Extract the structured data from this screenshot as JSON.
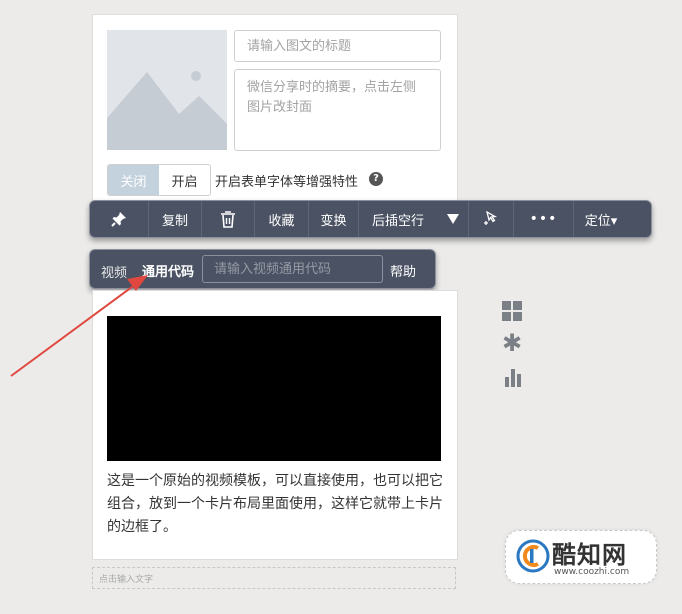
{
  "cover": {
    "title_placeholder": "请输入图文的标题",
    "summary_placeholder": "微信分享时的摘要，点击左侧图片改封面"
  },
  "enhance": {
    "off_label": "关闭",
    "on_label": "开启",
    "label": "开启表单字体等增强特性",
    "help_glyph": "?"
  },
  "toolbar": {
    "items": [
      {
        "name": "pin-icon",
        "label": ""
      },
      {
        "name": "copy-button",
        "label": "复制"
      },
      {
        "name": "trash-icon",
        "label": ""
      },
      {
        "name": "collect-button",
        "label": "收藏"
      },
      {
        "name": "transform-button",
        "label": "变换"
      },
      {
        "name": "insert-blank-line-button",
        "label": "后插空行"
      },
      {
        "name": "cursor-icon",
        "label": ""
      },
      {
        "name": "more-button",
        "label": "•••"
      },
      {
        "name": "position-button",
        "label": "定位▾"
      }
    ]
  },
  "video_bar": {
    "video_label": "视频",
    "code_label": "通用代码",
    "input_placeholder": "请输入视频通用代码",
    "help_label": "帮助"
  },
  "content": {
    "description": "这是一个原始的视频模板，可以直接使用，也可以把它组合，放到一个卡片布局里面使用，这样它就带上卡片的边框了。",
    "click_input_placeholder": "点击输入文字"
  },
  "watermark": {
    "name": "酷知网",
    "url": "www.coozhi.com"
  },
  "colors": {
    "toolbar_bg": "#4a5263",
    "arrow": "#e0473e",
    "accent_segment": "#c4d2de"
  }
}
